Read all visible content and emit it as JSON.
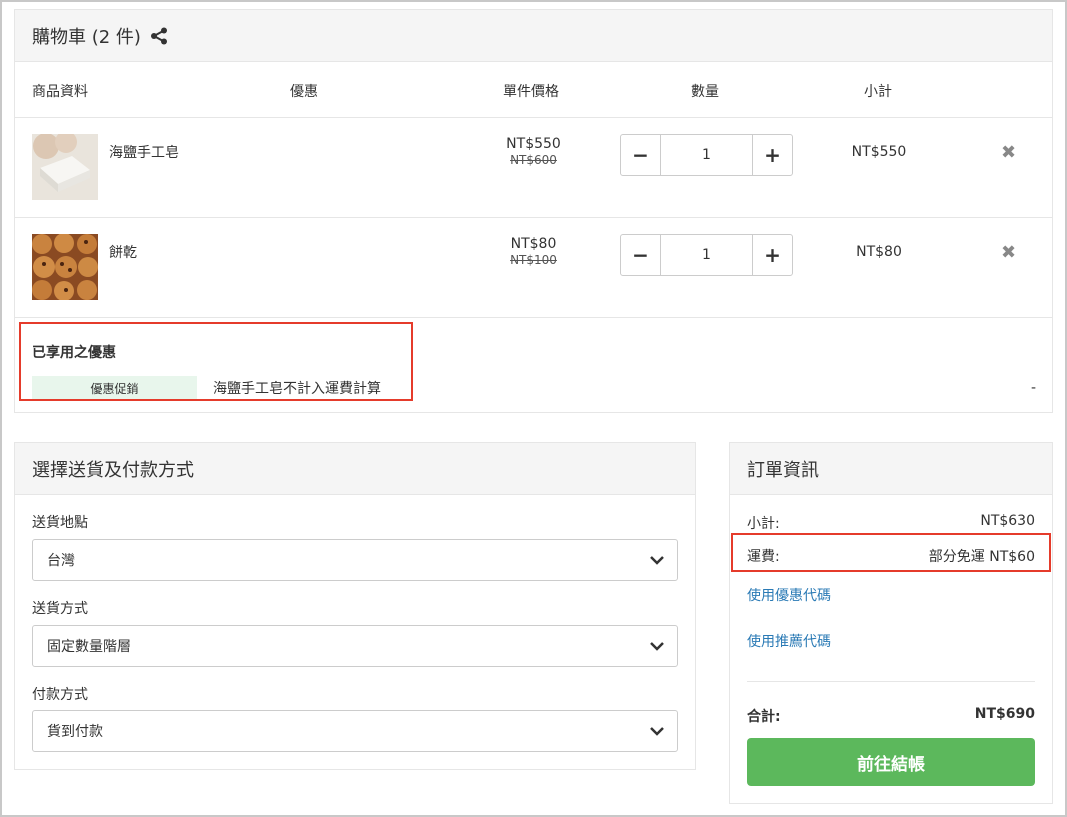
{
  "cart": {
    "title": "購物車 (2 件)",
    "columns": {
      "product": "商品資料",
      "discount": "優惠",
      "unit_price": "單件價格",
      "quantity": "數量",
      "subtotal": "小計"
    },
    "items": [
      {
        "name": "海鹽手工皂",
        "price": "NT$550",
        "original_price": "NT$600",
        "quantity": "1",
        "subtotal": "NT$550"
      },
      {
        "name": "餅乾",
        "price": "NT$80",
        "original_price": "NT$100",
        "quantity": "1",
        "subtotal": "NT$80"
      }
    ],
    "promo": {
      "title": "已享用之優惠",
      "tag": "優惠促銷",
      "description": "海鹽手工皂不計入運費計算",
      "value": "-"
    }
  },
  "delivery": {
    "title": "選擇送貨及付款方式",
    "location_label": "送貨地點",
    "location_value": "台灣",
    "method_label": "送貨方式",
    "method_value": "固定數量階層",
    "payment_label": "付款方式",
    "payment_value": "貨到付款"
  },
  "order": {
    "title": "訂單資訊",
    "subtotal_label": "小計:",
    "subtotal_value": "NT$630",
    "shipping_label": "運費:",
    "shipping_value": "部分免運 NT$60",
    "coupon_link": "使用優惠代碼",
    "referral_link": "使用推薦代碼",
    "total_label": "合計:",
    "total_value": "NT$690",
    "checkout_label": "前往結帳"
  },
  "colors": {
    "accent_green": "#5cb85c",
    "highlight_red": "#e53b2b",
    "link_blue": "#2a7ab5",
    "promo_tag_bg": "#e8f6ec"
  },
  "icons": {
    "share": "share-icon",
    "remove": "close-icon",
    "dropdown": "chevron-down-icon"
  }
}
